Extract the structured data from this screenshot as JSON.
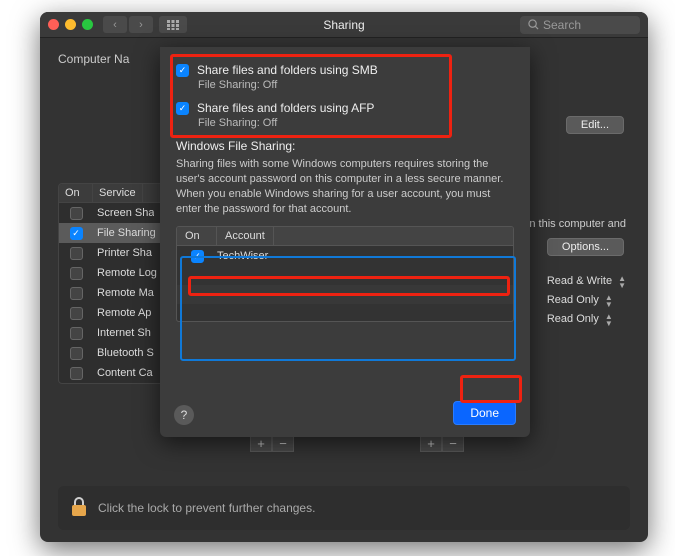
{
  "title": "Sharing",
  "search_placeholder": "Search",
  "computer_name_label": "Computer Na",
  "edit_label": "Edit...",
  "options_label": "Options...",
  "services": {
    "header_on": "On",
    "header_service": "Service",
    "items": [
      {
        "on": false,
        "name": "Screen Sha"
      },
      {
        "on": true,
        "name": "File Sharing",
        "selected": true
      },
      {
        "on": false,
        "name": "Printer Sha"
      },
      {
        "on": false,
        "name": "Remote Log"
      },
      {
        "on": false,
        "name": "Remote Ma"
      },
      {
        "on": false,
        "name": "Remote Ap"
      },
      {
        "on": false,
        "name": "Internet Sh"
      },
      {
        "on": false,
        "name": "Bluetooth S"
      },
      {
        "on": false,
        "name": "Content Ca"
      }
    ]
  },
  "right_info": "n this computer and",
  "permissions": [
    {
      "label": "Read & Write"
    },
    {
      "label": "Read Only"
    },
    {
      "label": "Read Only"
    }
  ],
  "lock_text": "Click the lock to prevent further changes.",
  "sheet": {
    "smb_label": "Share files and folders using SMB",
    "smb_status": "File Sharing: Off",
    "afp_label": "Share files and folders using AFP",
    "afp_status": "File Sharing: Off",
    "wfs_title": "Windows File Sharing:",
    "wfs_desc": "Sharing files with some Windows computers requires storing the user's account password on this computer in a less secure manner.  When you enable Windows sharing for a user account, you must enter the password for that account.",
    "acct_header_on": "On",
    "acct_header_account": "Account",
    "accounts": [
      {
        "on": true,
        "name": "TechWiser"
      }
    ],
    "done_label": "Done",
    "help_label": "?"
  }
}
